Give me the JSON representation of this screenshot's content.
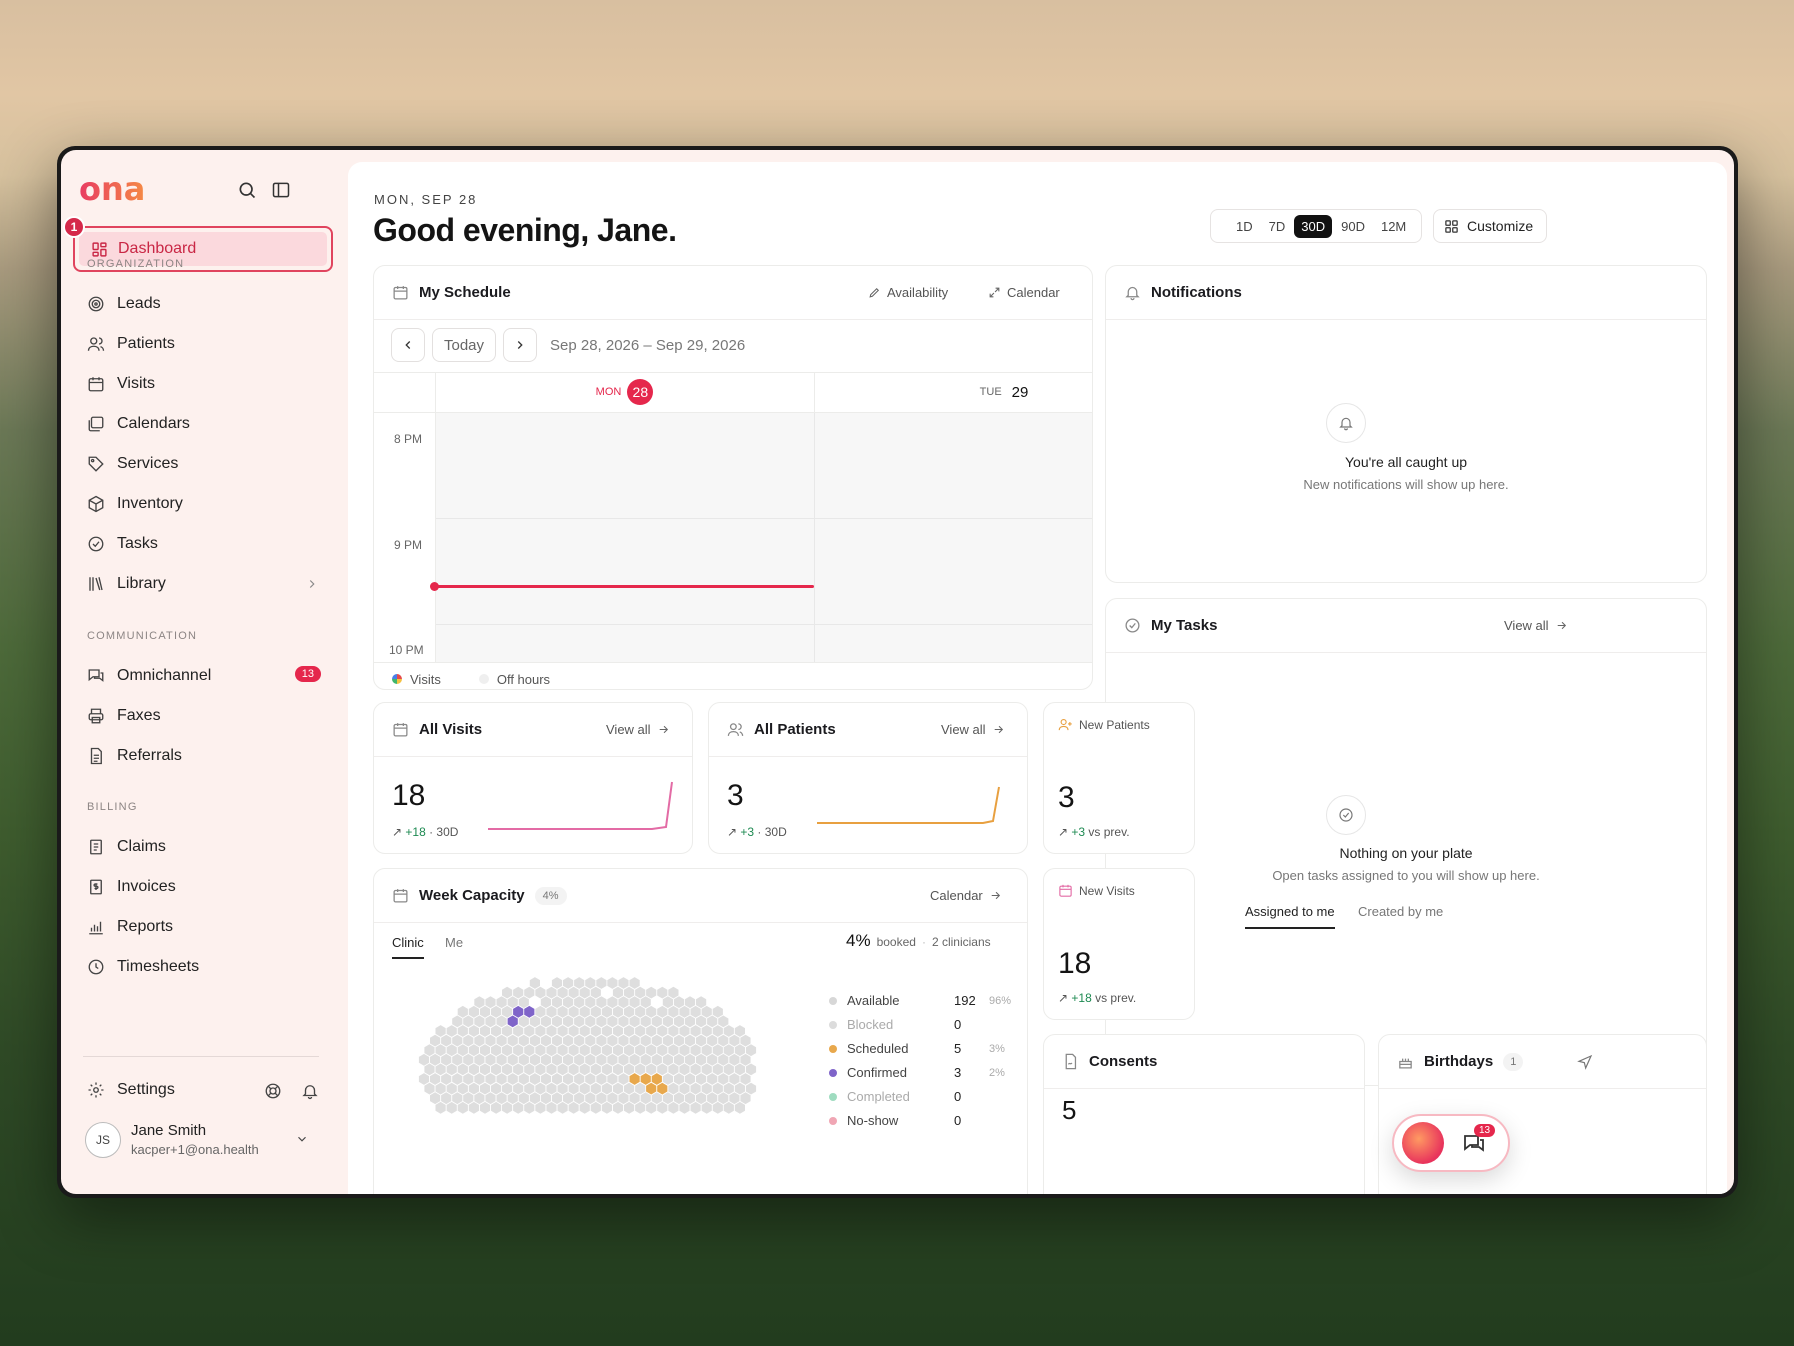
{
  "sidebar": {
    "logo": "ona",
    "active_item": "Dashboard",
    "active_badge": "1",
    "sections": {
      "organization": "ORGANIZATION",
      "communication": "COMMUNICATION",
      "billing": "BILLING"
    },
    "organization_items": [
      "Leads",
      "Patients",
      "Visits",
      "Calendars",
      "Services",
      "Inventory",
      "Tasks",
      "Library"
    ],
    "communication_items": [
      "Omnichannel",
      "Faxes",
      "Referrals"
    ],
    "omnichannel_count": "13",
    "billing_items": [
      "Claims",
      "Invoices",
      "Reports",
      "Timesheets"
    ],
    "settings": "Settings",
    "user": {
      "initials": "JS",
      "name": "Jane Smith",
      "email": "kacper+1@ona.health"
    }
  },
  "header": {
    "date": "MON, SEP 28",
    "greeting": "Good evening, Jane.",
    "ranges": [
      "1D",
      "7D",
      "30D",
      "90D",
      "12M"
    ],
    "selected_range": "30D",
    "customize": "Customize"
  },
  "schedule": {
    "title": "My Schedule",
    "availability": "Availability",
    "calendar": "Calendar",
    "today": "Today",
    "date_range": "Sep 28, 2026 – Sep 29, 2026",
    "days": [
      {
        "dow": "MON",
        "num": "28"
      },
      {
        "dow": "TUE",
        "num": "29"
      }
    ],
    "times": [
      "8 PM",
      "9 PM",
      "10 PM"
    ],
    "legend": [
      "Visits",
      "Off hours"
    ]
  },
  "notifications": {
    "title": "Notifications",
    "empty_title": "You're all caught up",
    "empty_sub": "New notifications will show up here."
  },
  "tasks": {
    "title": "My Tasks",
    "view_all": "View all",
    "empty_title": "Nothing on your plate",
    "empty_sub": "Open tasks assigned to you will show up here.",
    "tabs": [
      "Assigned to me",
      "Created by me"
    ]
  },
  "all_visits": {
    "title": "All Visits",
    "view_all": "View all",
    "value": "18",
    "delta": "+18",
    "period": "· 30D"
  },
  "all_patients": {
    "title": "All Patients",
    "view_all": "View all",
    "value": "3",
    "delta": "+3",
    "period": "· 30D"
  },
  "new_patients": {
    "title": "New Patients",
    "value": "3",
    "delta": "+3",
    "suffix": "vs prev."
  },
  "new_visits": {
    "title": "New Visits",
    "value": "18",
    "delta": "+18",
    "suffix": "vs prev."
  },
  "capacity": {
    "title": "Week Capacity",
    "badge": "4%",
    "calendar": "Calendar",
    "tabs": [
      "Clinic",
      "Me"
    ],
    "booked_pct": "4%",
    "booked_label": "booked",
    "clinicians": "2 clinicians",
    "legend": [
      {
        "label": "Available",
        "value": "192",
        "pct": "96%",
        "color": "#d7d7d7"
      },
      {
        "label": "Blocked",
        "value": "0",
        "pct": "",
        "color": "#dcdcdc"
      },
      {
        "label": "Scheduled",
        "value": "5",
        "pct": "3%",
        "color": "#e8a84c"
      },
      {
        "label": "Confirmed",
        "value": "3",
        "pct": "2%",
        "color": "#7f64c9"
      },
      {
        "label": "Completed",
        "value": "0",
        "pct": "",
        "color": "#9fdcc0"
      },
      {
        "label": "No-show",
        "value": "0",
        "pct": "",
        "color": "#f0a6b4"
      }
    ]
  },
  "consents": {
    "title": "Consents",
    "value": "5"
  },
  "birthdays": {
    "title": "Birthdays",
    "count": "1"
  },
  "chat": {
    "count": "13"
  },
  "colors": {
    "accent": "#e5274c",
    "visits_line": "#e36ba5",
    "patients_line": "#e8a040",
    "positive": "#1e8a52"
  }
}
